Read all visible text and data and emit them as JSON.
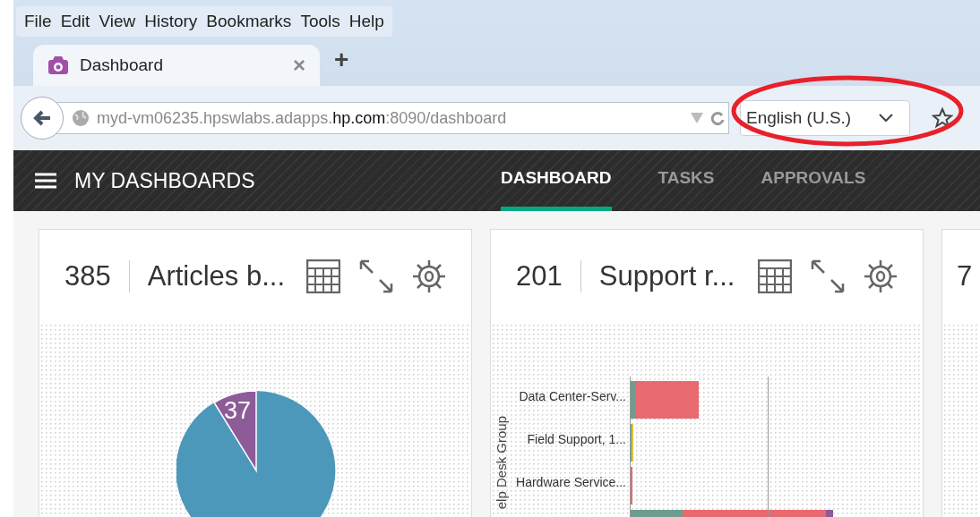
{
  "menu_bar": [
    "File",
    "Edit",
    "View",
    "History",
    "Bookmarks",
    "Tools",
    "Help"
  ],
  "tabs": [
    {
      "title": "Dashboard",
      "close": "×",
      "selected": true
    }
  ],
  "new_tab": "+",
  "address_bar": {
    "url_start": "myd-vm06235.hpswlabs.adapps.",
    "url_domain": "hp.com",
    "url_end": ":8090/dashboard"
  },
  "language_select": {
    "value": "English (U.S.)"
  },
  "annotation": {
    "kind": "ellipse",
    "color": "#e8202a"
  },
  "app_header": {
    "title": "MY DASHBOARDS",
    "nav": [
      {
        "label": "DASHBOARD",
        "selected": true
      },
      {
        "label": "TASKS",
        "selected": false
      },
      {
        "label": "APPROVALS",
        "selected": false
      }
    ]
  },
  "widgets": [
    {
      "kind": "pie",
      "count": "385",
      "title": "Articles b...",
      "pie_label": "37"
    },
    {
      "kind": "bar",
      "count": "201",
      "title": "Support r...",
      "axis_title": "elp Desk Group",
      "categories": [
        "Data Center-Serv...",
        "Field Support, 1...",
        "Hardware Service..."
      ]
    },
    {
      "kind": "partial",
      "count": "7"
    }
  ]
}
